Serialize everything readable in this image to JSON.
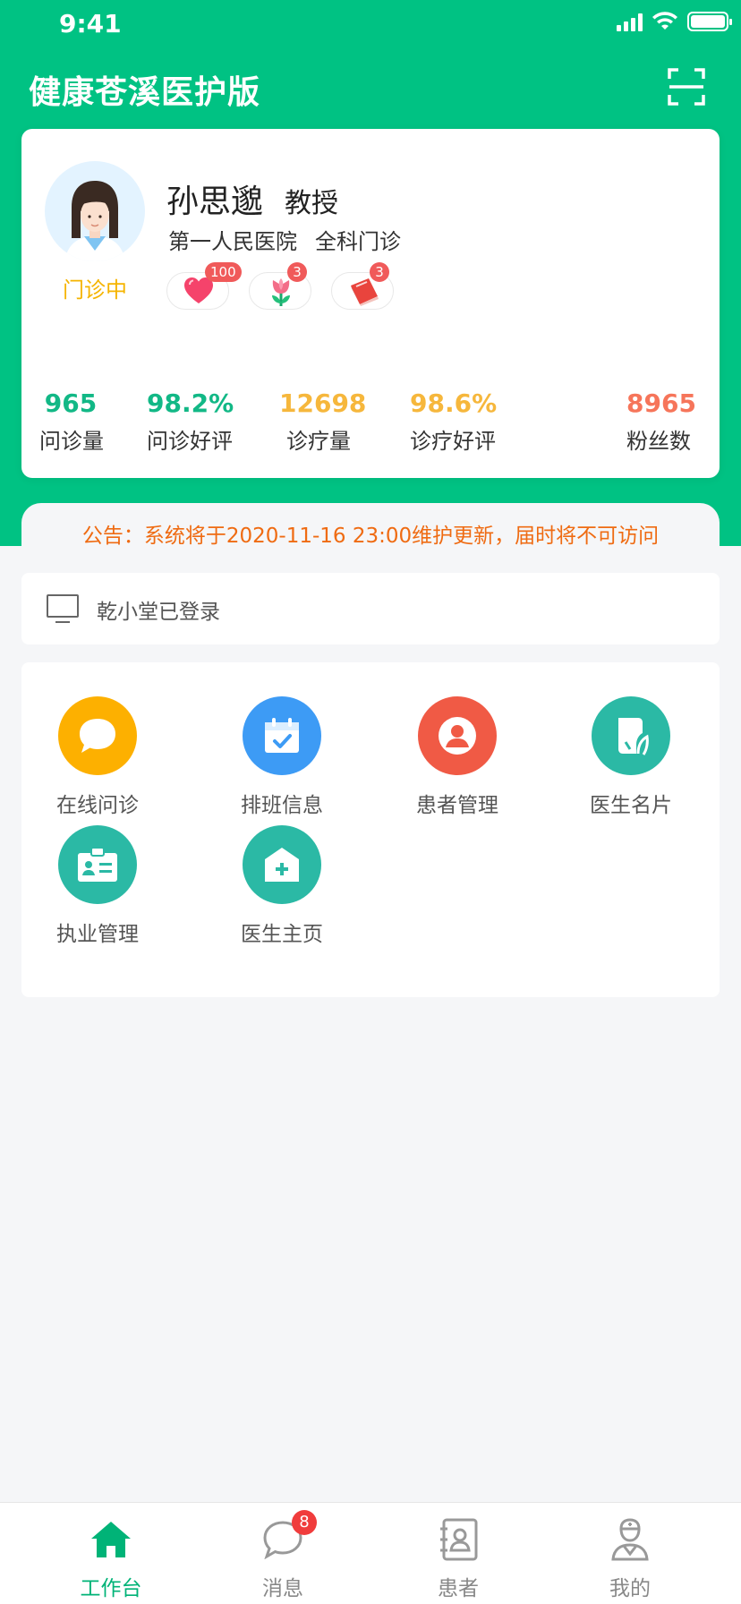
{
  "status_bar": {
    "time": "9:41"
  },
  "header": {
    "title": "健康苍溪医护版",
    "scan_icon": "scan-icon"
  },
  "profile": {
    "name": "孙思邈",
    "title": "教授",
    "hospital": "第一人民医院",
    "department": "全科门诊",
    "status": "门诊中",
    "awards": [
      {
        "icon": "heart-icon",
        "count": "100"
      },
      {
        "icon": "flower-icon",
        "count": "3"
      },
      {
        "icon": "book-icon",
        "count": "3"
      }
    ],
    "stats": [
      {
        "value": "965",
        "label": "问诊量",
        "color": "#12b886"
      },
      {
        "value": "98.2%",
        "label": "问诊好评",
        "color": "#12b886"
      },
      {
        "value": "12698",
        "label": "诊疗量",
        "color": "#f6b73c"
      },
      {
        "value": "98.6%",
        "label": "诊疗好评",
        "color": "#f6b73c"
      },
      {
        "value": "8965",
        "label": "粉丝数",
        "color": "#f6755a"
      }
    ]
  },
  "notice": {
    "text": "公告：系统将于2020-11-16  23:00维护更新，届时将不可访问"
  },
  "login": {
    "text": "乾小堂已登录",
    "icon": "monitor-icon"
  },
  "functions": [
    {
      "label": "在线问诊",
      "icon": "chat-icon",
      "color": "#fdb000"
    },
    {
      "label": "排班信息",
      "icon": "calendar-icon",
      "color": "#3d9bf5"
    },
    {
      "label": "患者管理",
      "icon": "patient-icon",
      "color": "#f05a45"
    },
    {
      "label": "医生名片",
      "icon": "card-icon",
      "color": "#2bb9a5"
    },
    {
      "label": "执业管理",
      "icon": "license-icon",
      "color": "#2bb9a5"
    },
    {
      "label": "医生主页",
      "icon": "home-plus-icon",
      "color": "#2bb9a5"
    }
  ],
  "bottom_nav": {
    "items": [
      {
        "label": "工作台",
        "icon": "home-icon",
        "active": true
      },
      {
        "label": "消息",
        "icon": "message-icon",
        "badge": "8"
      },
      {
        "label": "患者",
        "icon": "contacts-icon"
      },
      {
        "label": "我的",
        "icon": "doctor-icon"
      }
    ]
  }
}
